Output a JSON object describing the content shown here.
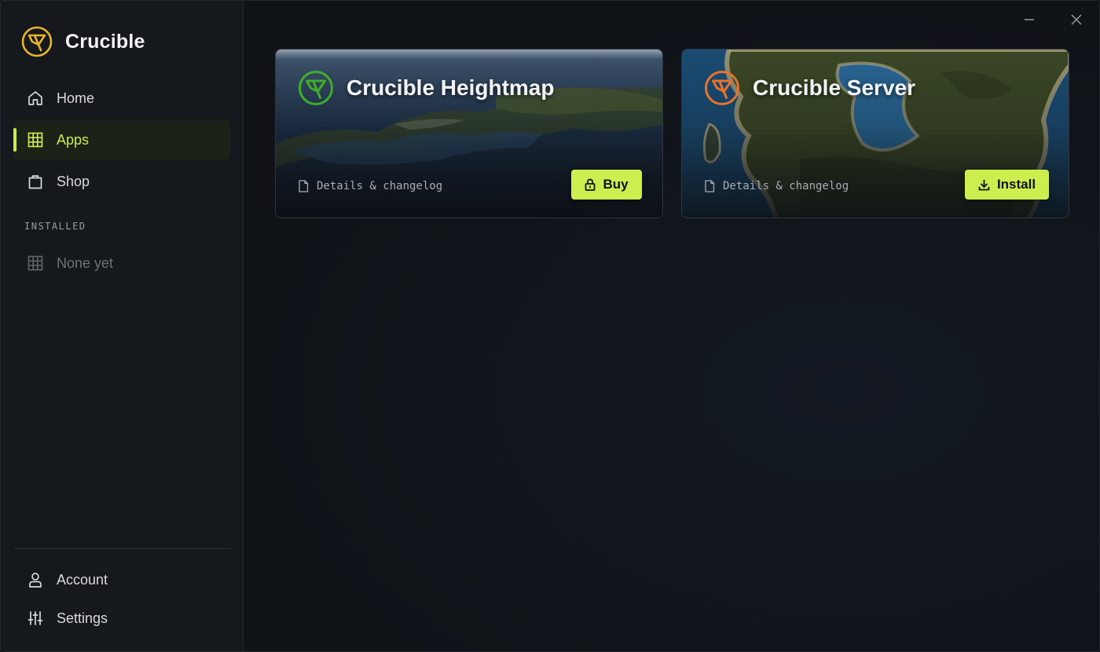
{
  "app": {
    "name": "Crucible",
    "accent": "#cdee4f",
    "logo_icon": "crucible-logo-icon"
  },
  "sidebar": {
    "nav": [
      {
        "label": "Home",
        "icon": "home-icon",
        "active": false
      },
      {
        "label": "Apps",
        "icon": "grid-icon",
        "active": true
      },
      {
        "label": "Shop",
        "icon": "shopping-bag-icon",
        "active": false
      }
    ],
    "installed_section": "INSTALLED",
    "installed_empty": "None yet",
    "bottom": [
      {
        "label": "Account",
        "icon": "user-icon"
      },
      {
        "label": "Settings",
        "icon": "sliders-icon"
      }
    ]
  },
  "window_controls": {
    "minimize_icon": "minimize-icon",
    "close_icon": "close-icon"
  },
  "apps": [
    {
      "title": "Crucible Heightmap",
      "logo_color": "#3fae2c",
      "details_link": "Details & changelog",
      "action_label": "Buy",
      "action_icon": "lock-icon"
    },
    {
      "title": "Crucible Server",
      "logo_color": "#e8742c",
      "details_link": "Details & changelog",
      "action_label": "Install",
      "action_icon": "download-icon"
    }
  ]
}
